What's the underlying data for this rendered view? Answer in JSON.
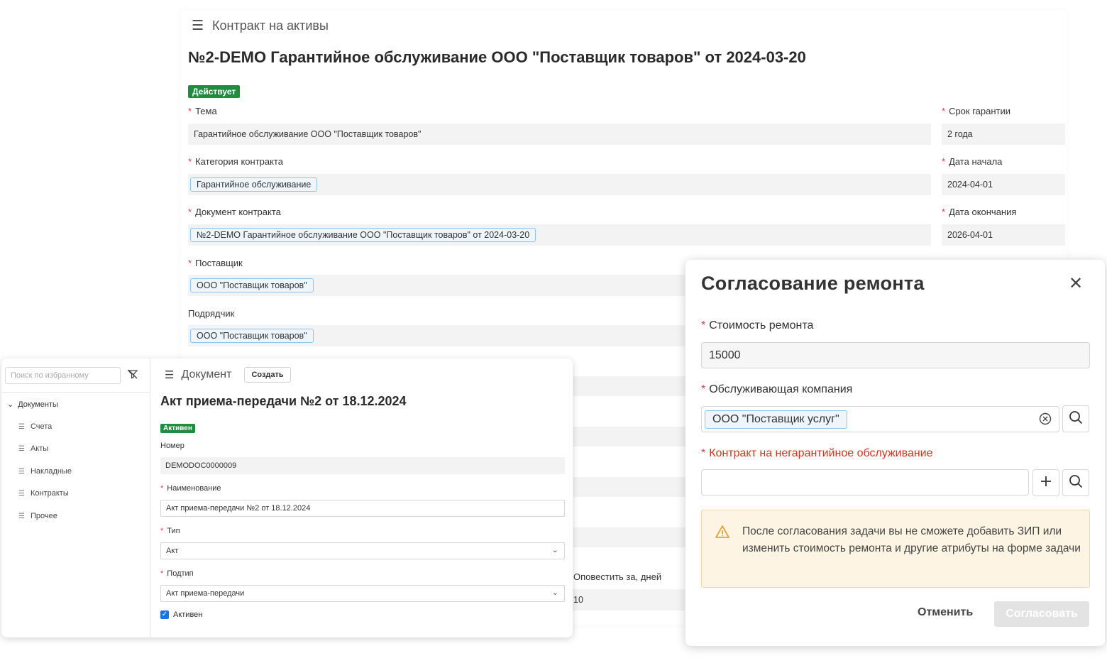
{
  "contract": {
    "header_title": "Контракт на активы",
    "title": "№2-DEMO Гарантийное обслуживание ООО \"Поставщик товаров\" от 2024-03-20",
    "status": "Действует",
    "topic_label": "Тема",
    "topic_value": "Гарантийное обслуживание ООО \"Поставщик товаров\"",
    "category_label": "Категория контракта",
    "category_value": "Гарантийное обслуживание",
    "document_label": "Документ контракта",
    "document_value": "№2-DEMO Гарантийное обслуживание ООО \"Поставщик товаров\" от 2024-03-20",
    "supplier_label": "Поставщик",
    "supplier_value": "ООО \"Поставщик товаров\"",
    "contractor_label": "Подрядчик",
    "contractor_value": "ООО \"Поставщик товаров\"",
    "warranty_label": "Срок гарантии",
    "warranty_value": "2 года",
    "start_label": "Дата начала",
    "start_value": "2024-04-01",
    "end_label": "Дата окончания",
    "end_value": "2026-04-01",
    "notify_label": "Оповестить за, дней",
    "notify_value": "10"
  },
  "sidebar": {
    "search_placeholder": "Поиск по избранному",
    "group_label": "Документы",
    "items": [
      {
        "label": "Счета"
      },
      {
        "label": "Акты"
      },
      {
        "label": "Накладные"
      },
      {
        "label": "Контракты"
      },
      {
        "label": "Прочее"
      }
    ]
  },
  "document": {
    "header_title": "Документ",
    "create_label": "Создать",
    "title": "Акт приема-передачи №2 от 18.12.2024",
    "status": "Активен",
    "number_label": "Номер",
    "number_value": "DEMODOC0000009",
    "name_label": "Наименование",
    "name_value": "Акт приема-передачи №2 от 18.12.2024",
    "type_label": "Тип",
    "type_value": "Акт",
    "subtype_label": "Подтип",
    "subtype_value": "Акт приема-передачи",
    "active_label": "Активен",
    "active_checked": true
  },
  "modal": {
    "title": "Согласование ремонта",
    "cost_label": "Стоимость ремонта",
    "cost_value": "15000",
    "company_label": "Обслуживающая компания",
    "company_value": "ООО \"Поставщик услуг\"",
    "contract_label": "Контракт на негарантийное обслуживание",
    "contract_value": "",
    "warning_text": "После согласования задачи вы не сможете добавить ЗИП или изменить стоимость ремонта и другие атрибуты на форме задачи",
    "cancel_label": "Отменить",
    "approve_label": "Согласовать"
  },
  "colors": {
    "status_green": "#1e8e3e",
    "required_red": "#e04141",
    "error_red": "#d0341f",
    "tag_border": "#8cc4ee",
    "warning_bg": "#fdf4e3",
    "warning_icon": "#e2a33b",
    "checkbox_blue": "#1a73e8"
  },
  "icons": {
    "menu": "hamburger-icon",
    "close": "close-icon",
    "search": "search-icon",
    "clear": "clear-circle-icon",
    "add": "plus-icon",
    "warning": "warning-triangle-icon",
    "filter_off": "filter-off-icon",
    "list": "list-icon",
    "chevron": "chevron-down-icon",
    "check": "checkmark-icon"
  }
}
